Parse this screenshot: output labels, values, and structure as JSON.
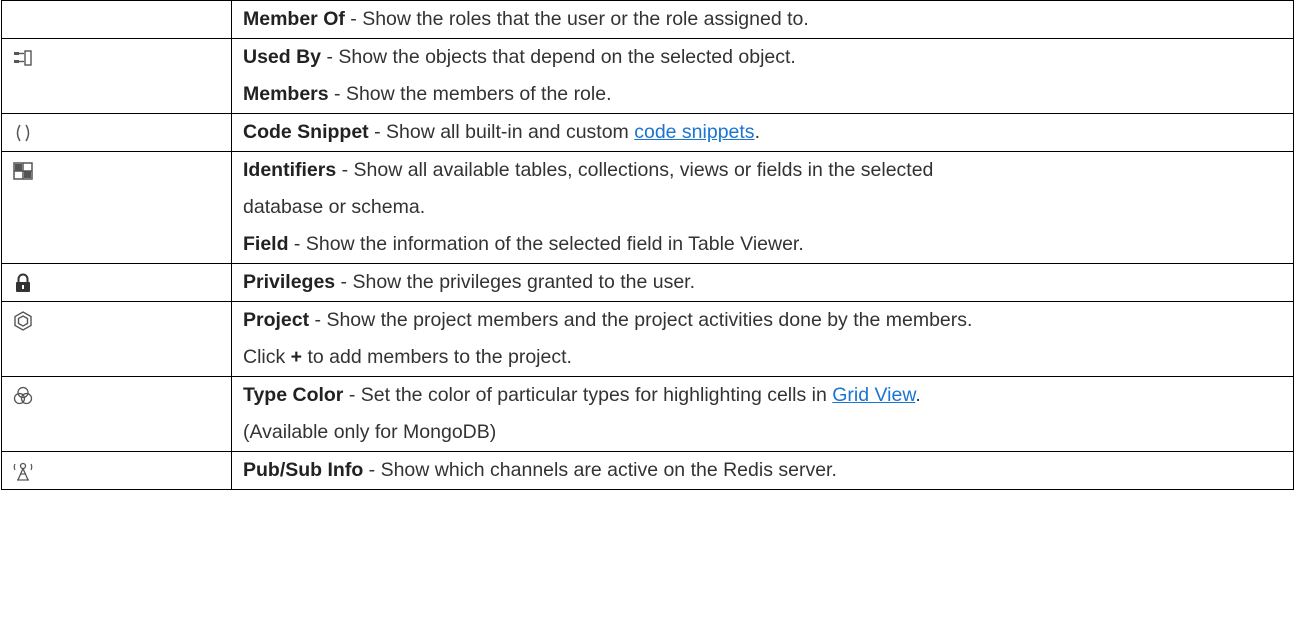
{
  "rows": [
    {
      "icon": "",
      "lines": [
        {
          "bold": "Member Of",
          "text": " - Show the roles that the user or the role assigned to."
        }
      ]
    },
    {
      "icon": "used-by-icon",
      "lines": [
        {
          "bold": "Used By",
          "text": " - Show the objects that depend on the selected object."
        },
        {
          "bold": "Members",
          "text": " - Show the members of the role."
        }
      ]
    },
    {
      "icon": "code-snippet-icon",
      "lines": [
        {
          "bold": "Code Snippet",
          "text": " - Show all built-in and custom ",
          "link": "code snippets",
          "after": "."
        }
      ]
    },
    {
      "icon": "identifiers-icon",
      "lines": [
        {
          "bold": "Identifiers",
          "text": " - Show all available tables, collections, views or fields in the selected"
        },
        {
          "text": "database or schema."
        },
        {
          "bold": "Field",
          "text": " - Show the information of the selected field in Table Viewer."
        }
      ]
    },
    {
      "icon": "lock-icon",
      "lines": [
        {
          "bold": "Privileges",
          "text": " - Show the privileges granted to the user."
        }
      ]
    },
    {
      "icon": "project-icon",
      "lines": [
        {
          "bold": "Project",
          "text": " - Show the project members and the project activities done by the members."
        },
        {
          "text": "Click ",
          "bold2": "+",
          "after": " to add members to the project."
        }
      ]
    },
    {
      "icon": "type-color-icon",
      "lines": [
        {
          "bold": "Type Color",
          "text": " - Set the color of particular types for highlighting cells in ",
          "link": "Grid View",
          "after": "."
        },
        {
          "text": "(Available only for MongoDB)"
        }
      ]
    },
    {
      "icon": "pubsub-icon",
      "lines": [
        {
          "bold": "Pub/Sub Info",
          "text": " - Show which channels are active on the Redis server."
        }
      ]
    }
  ]
}
